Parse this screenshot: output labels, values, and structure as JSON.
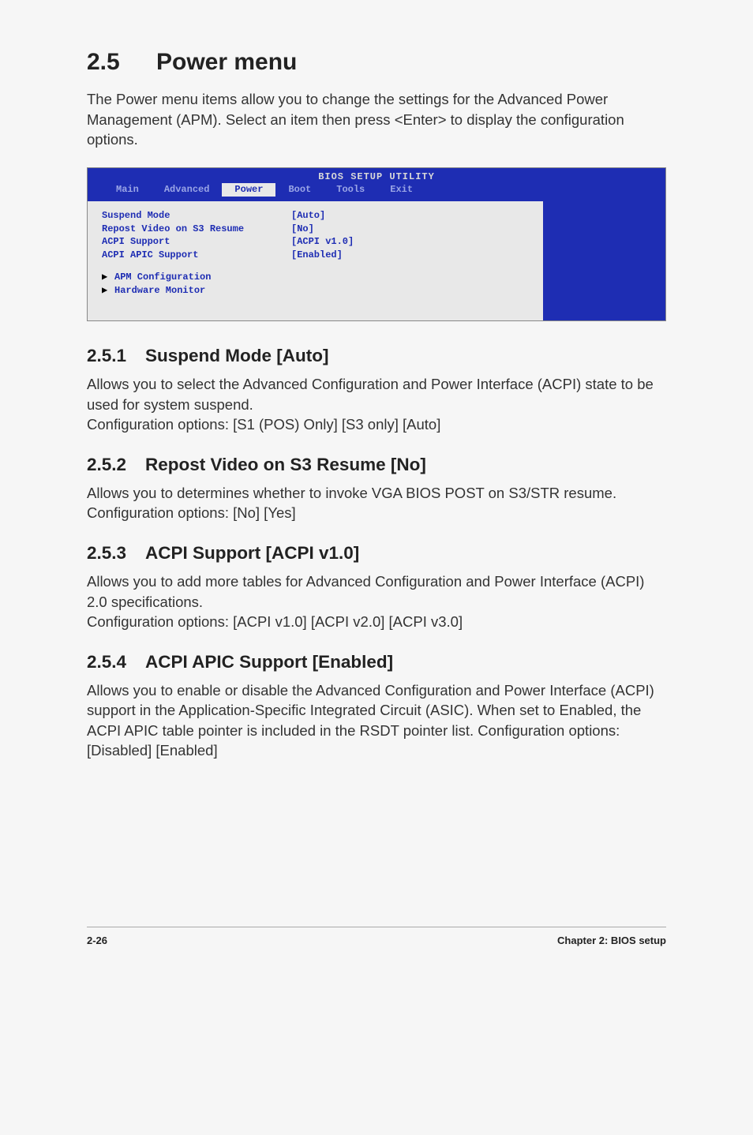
{
  "section": {
    "number": "2.5",
    "title": "Power menu",
    "intro": "The Power menu items allow you to change the settings for the Advanced Power Management (APM). Select an item then press <Enter> to display the configuration options."
  },
  "bios": {
    "title": "BIOS SETUP UTILITY",
    "tabs": [
      "Main",
      "Advanced",
      "Power",
      "Boot",
      "Tools",
      "Exit"
    ],
    "active_tab": "Power",
    "rows": [
      {
        "label": "Suspend Mode",
        "value": "[Auto]"
      },
      {
        "label": "Repost Video on S3 Resume",
        "value": "[No]"
      },
      {
        "label": "ACPI Support",
        "value": "[ACPI v1.0]"
      },
      {
        "label": "ACPI APIC Support",
        "value": "[Enabled]"
      }
    ],
    "submenus": [
      "APM Configuration",
      "Hardware Monitor"
    ]
  },
  "subsections": [
    {
      "num": "2.5.1",
      "title": "Suspend Mode [Auto]",
      "body1": "Allows you to select the Advanced Configuration and Power Interface (ACPI) state to be used for system suspend.",
      "body2": "Configuration options: [S1 (POS) Only] [S3 only] [Auto]"
    },
    {
      "num": "2.5.2",
      "title": "Repost Video on S3 Resume [No]",
      "body1": "Allows you to determines whether to invoke VGA BIOS POST on S3/STR resume. Configuration options: [No] [Yes]",
      "body2": ""
    },
    {
      "num": "2.5.3",
      "title": "ACPI Support [ACPI v1.0]",
      "body1": "Allows you to add more tables for Advanced Configuration and Power Interface (ACPI) 2.0 specifications.",
      "body2": "Configuration options: [ACPI v1.0] [ACPI v2.0] [ACPI v3.0]"
    },
    {
      "num": "2.5.4",
      "title": "ACPI APIC Support [Enabled]",
      "body1": "Allows you to enable or disable the Advanced Configuration and Power Interface (ACPI) support in the Application-Specific Integrated Circuit (ASIC). When set to Enabled, the ACPI APIC table pointer is included in the RSDT pointer list. Configuration options: [Disabled] [Enabled]",
      "body2": ""
    }
  ],
  "footer": {
    "page": "2-26",
    "chapter": "Chapter 2: BIOS setup"
  }
}
